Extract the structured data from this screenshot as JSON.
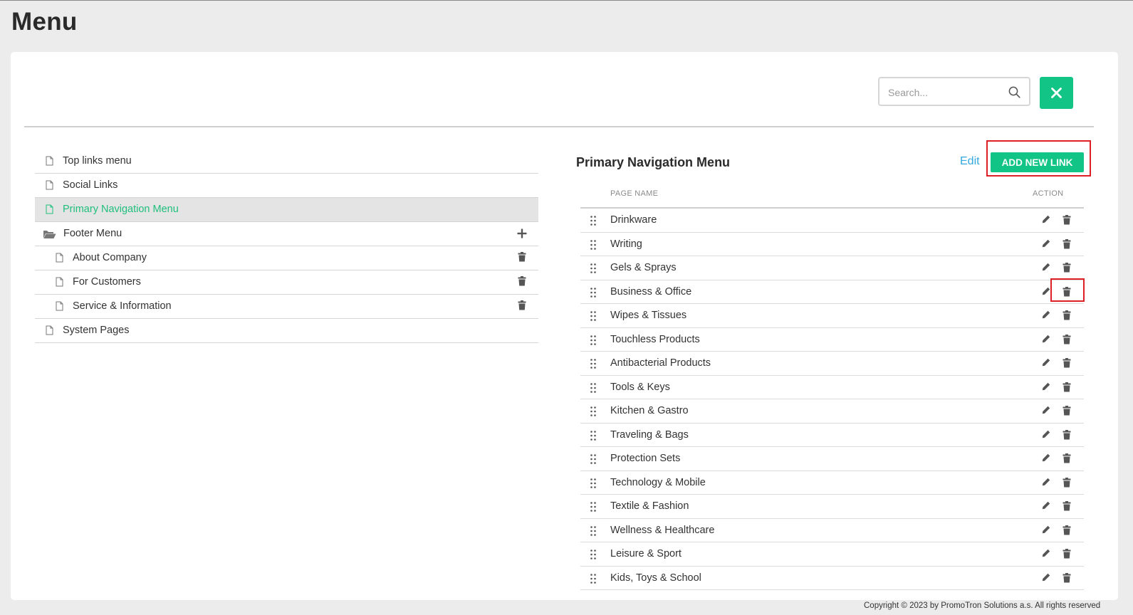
{
  "page": {
    "title": "Menu"
  },
  "toolbar": {
    "search_placeholder": "Search..."
  },
  "tree": {
    "items": [
      {
        "label": "Top links menu"
      },
      {
        "label": "Social Links"
      },
      {
        "label": "Primary Navigation Menu",
        "active": true
      },
      {
        "label": "Footer Menu",
        "folder": true
      },
      {
        "label": "About Company",
        "child": true
      },
      {
        "label": "For Customers",
        "child": true
      },
      {
        "label": "Service & Information",
        "child": true
      },
      {
        "label": "System Pages"
      }
    ]
  },
  "menu": {
    "title": "Primary Navigation Menu",
    "edit_label": "Edit",
    "add_label": "ADD NEW LINK",
    "columns": {
      "page_name": "PAGE NAME",
      "action": "ACTION"
    },
    "rows": [
      "Drinkware",
      "Writing",
      "Gels & Sprays",
      "Business & Office",
      "Wipes & Tissues",
      "Touchless Products",
      "Antibacterial Products",
      "Tools & Keys",
      "Kitchen & Gastro",
      "Traveling & Bags",
      "Protection Sets",
      "Technology & Mobile",
      "Textile & Fashion",
      "Wellness & Healthcare",
      "Leisure & Sport",
      "Kids, Toys & School"
    ]
  },
  "footer": {
    "text": "Copyright © 2023 by PromoTron Solutions a.s. All rights reserved"
  },
  "colors": {
    "accent": "#12c486",
    "active_text": "#1fbf7d",
    "link": "#33a9de",
    "highlight": "#dd1f26"
  }
}
